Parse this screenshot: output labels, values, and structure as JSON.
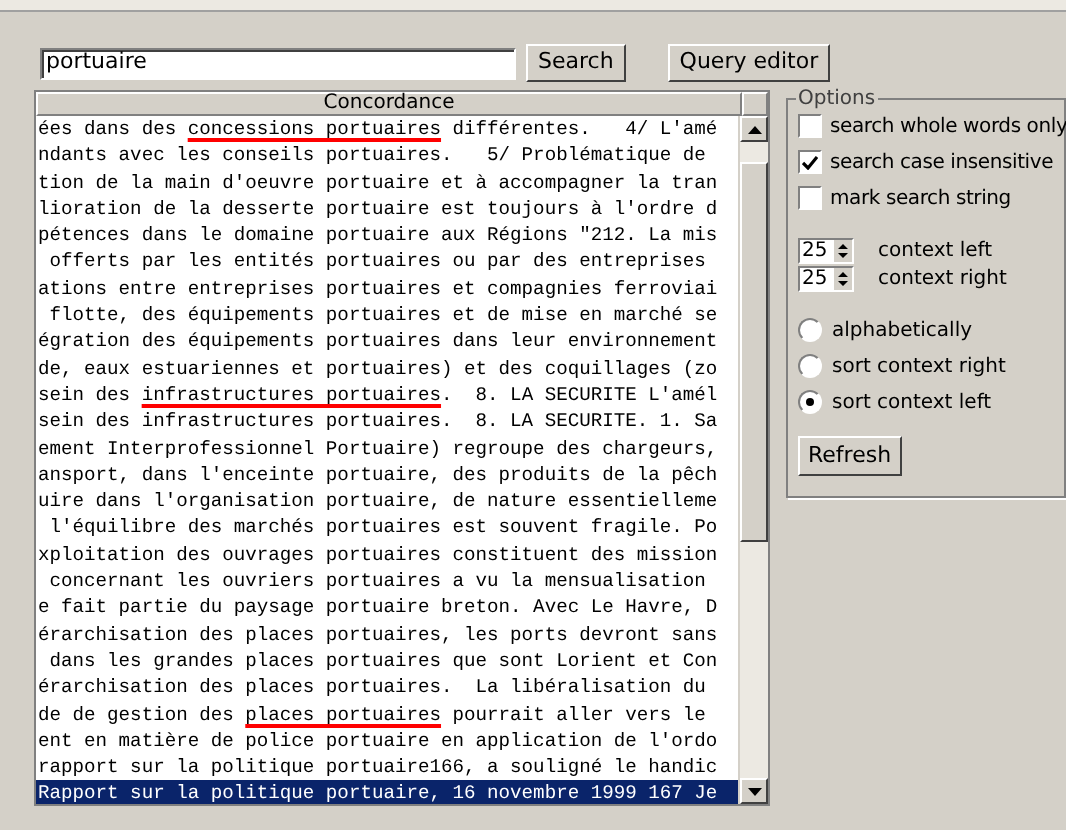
{
  "search": {
    "value": "portuaire",
    "button": "Search"
  },
  "query_editor": {
    "label": "Query editor"
  },
  "concordance": {
    "header": "Concordance",
    "lines": [
      {
        "selected": false,
        "segments": [
          {
            "text": "ées dans des ",
            "underlined": false
          },
          {
            "text": "concessions portuaires",
            "underlined": true
          },
          {
            "text": " différentes.   4/ L'amé",
            "underlined": false
          }
        ]
      },
      {
        "selected": false,
        "segments": [
          {
            "text": "ndants avec les conseils portuaires.   5/ Problématique de",
            "underlined": false
          }
        ]
      },
      {
        "selected": false,
        "segments": [
          {
            "text": "tion de la main d'oeuvre portuaire et à accompagner la tran",
            "underlined": false
          }
        ]
      },
      {
        "selected": false,
        "segments": [
          {
            "text": "lioration de la desserte portuaire est toujours à l'ordre d",
            "underlined": false
          }
        ]
      },
      {
        "selected": false,
        "segments": [
          {
            "text": "pétences dans le domaine portuaire aux Régions \"212. La mis",
            "underlined": false
          }
        ]
      },
      {
        "selected": false,
        "segments": [
          {
            "text": " offerts par les entités portuaires ou par des entreprises",
            "underlined": false
          }
        ]
      },
      {
        "selected": false,
        "segments": [
          {
            "text": "ations entre entreprises portuaires et compagnies ferroviai",
            "underlined": false
          }
        ]
      },
      {
        "selected": false,
        "segments": [
          {
            "text": " flotte, des équipements portuaires et de mise en marché se",
            "underlined": false
          }
        ]
      },
      {
        "selected": false,
        "segments": [
          {
            "text": "égration des équipements portuaires dans leur environnement",
            "underlined": false
          }
        ]
      },
      {
        "selected": false,
        "segments": [
          {
            "text": "de, eaux estuariennes et portuaires) et des coquillages (zo",
            "underlined": false
          }
        ]
      },
      {
        "selected": false,
        "segments": [
          {
            "text": "sein des ",
            "underlined": false
          },
          {
            "text": "infrastructures portuaires",
            "underlined": true
          },
          {
            "text": ".  8. LA SECURITE L'amél",
            "underlined": false
          }
        ]
      },
      {
        "selected": false,
        "segments": [
          {
            "text": "sein des infrastructures portuaires.  8. LA SECURITE. 1. Sa",
            "underlined": false
          }
        ]
      },
      {
        "selected": false,
        "segments": [
          {
            "text": "ement Interprofessionnel Portuaire) regroupe des chargeurs,",
            "underlined": false
          }
        ]
      },
      {
        "selected": false,
        "segments": [
          {
            "text": "ansport, dans l'enceinte portuaire, des produits de la pêch",
            "underlined": false
          }
        ]
      },
      {
        "selected": false,
        "segments": [
          {
            "text": "uire dans l'organisation portuaire, de nature essentielleme",
            "underlined": false
          }
        ]
      },
      {
        "selected": false,
        "segments": [
          {
            "text": " l'équilibre des marchés portuaires est souvent fragile. Po",
            "underlined": false
          }
        ]
      },
      {
        "selected": false,
        "segments": [
          {
            "text": "xploitation des ouvrages portuaires constituent des mission",
            "underlined": false
          }
        ]
      },
      {
        "selected": false,
        "segments": [
          {
            "text": " concernant les ouvriers portuaires a vu la mensualisation",
            "underlined": false
          }
        ]
      },
      {
        "selected": false,
        "segments": [
          {
            "text": "e fait partie du paysage portuaire breton. Avec Le Havre, D",
            "underlined": false
          }
        ]
      },
      {
        "selected": false,
        "segments": [
          {
            "text": "érarchisation des places portuaires, les ports devront sans",
            "underlined": false
          }
        ]
      },
      {
        "selected": false,
        "segments": [
          {
            "text": " dans les grandes places portuaires que sont Lorient et Con",
            "underlined": false
          }
        ]
      },
      {
        "selected": false,
        "segments": [
          {
            "text": "érarchisation des places portuaires.  La libéralisation du",
            "underlined": false
          }
        ]
      },
      {
        "selected": false,
        "segments": [
          {
            "text": "de de gestion des ",
            "underlined": false
          },
          {
            "text": "places portuaires",
            "underlined": true
          },
          {
            "text": " pourrait aller vers le",
            "underlined": false
          }
        ]
      },
      {
        "selected": false,
        "segments": [
          {
            "text": "ent en matière de police portuaire en application de l'ordo",
            "underlined": false
          }
        ]
      },
      {
        "selected": false,
        "segments": [
          {
            "text": "rapport sur la politique portuaire166, a souligné le handic",
            "underlined": false
          }
        ]
      },
      {
        "selected": true,
        "segments": [
          {
            "text": "Rapport sur la politique portuaire, 16 novembre 1999 167 Je",
            "underlined": false
          }
        ]
      }
    ]
  },
  "options": {
    "title": "Options",
    "checkboxes": [
      {
        "label": "search whole words only",
        "checked": false
      },
      {
        "label": "search case insensitive",
        "checked": true
      },
      {
        "label": "mark search string",
        "checked": false
      }
    ],
    "spinners": [
      {
        "value": "25",
        "label": "context left"
      },
      {
        "value": "25",
        "label": "context right"
      }
    ],
    "radios": [
      {
        "label": "alphabetically",
        "selected": false
      },
      {
        "label": "sort context right",
        "selected": false
      },
      {
        "label": "sort context left",
        "selected": true
      }
    ],
    "refresh": "Refresh"
  }
}
